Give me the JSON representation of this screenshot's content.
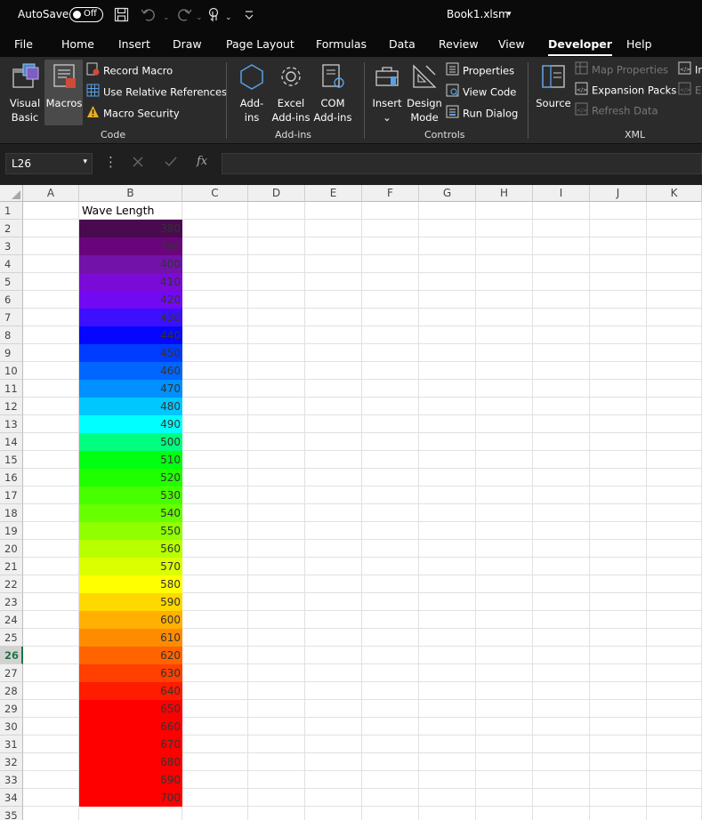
{
  "titlebar": {
    "autosave_label": "AutoSave",
    "toggle_label": "Off",
    "filename": "Book1.xlsm",
    "filename_caret": "▾"
  },
  "tabs": [
    "File",
    "Home",
    "Insert",
    "Draw",
    "Page Layout",
    "Formulas",
    "Data",
    "Review",
    "View",
    "Developer",
    "Help"
  ],
  "active_tab": "Developer",
  "ribbon": {
    "code": {
      "label": "Code",
      "visual_basic": [
        "Visual",
        "Basic"
      ],
      "macros": "Macros",
      "record_macro": "Record Macro",
      "relative_refs": "Use Relative References",
      "macro_security": "Macro Security"
    },
    "addins": {
      "label": "Add-ins",
      "addins": [
        "Add-",
        "ins"
      ],
      "excel_addins": [
        "Excel",
        "Add-ins"
      ],
      "com_addins": [
        "COM",
        "Add-ins"
      ]
    },
    "controls": {
      "label": "Controls",
      "insert": "Insert",
      "insert_caret": "⌄",
      "design_mode": [
        "Design",
        "Mode"
      ],
      "properties": "Properties",
      "view_code": "View Code",
      "run_dialog": "Run Dialog"
    },
    "xml": {
      "label": "XML",
      "source": "Source",
      "map_properties": "Map Properties",
      "expansion_packs": "Expansion Packs",
      "refresh_data": "Refresh Data",
      "clipped_1": "In",
      "clipped_2": "Ex"
    }
  },
  "formula_bar": {
    "name_box": "L26",
    "name_box_caret": "▾",
    "formula_value": ""
  },
  "sheet": {
    "columns": [
      "A",
      "B",
      "C",
      "D",
      "E",
      "F",
      "G",
      "H",
      "I",
      "J",
      "K"
    ],
    "rows": [
      "1",
      "2",
      "3",
      "4",
      "5",
      "6",
      "7",
      "8",
      "9",
      "10",
      "11",
      "12",
      "13",
      "14",
      "15",
      "16",
      "17",
      "18",
      "19",
      "20",
      "21",
      "22",
      "23",
      "24",
      "25",
      "26",
      "27",
      "28",
      "29",
      "30",
      "31",
      "32",
      "33",
      "34",
      "35"
    ],
    "selected_row": "26",
    "header": "Wave Length",
    "cells": [
      {
        "value": "380",
        "color": "#4a0a4e"
      },
      {
        "value": "390",
        "color": "#6a047d"
      },
      {
        "value": "400",
        "color": "#7212a8"
      },
      {
        "value": "410",
        "color": "#7a0ad6"
      },
      {
        "value": "420",
        "color": "#7209f3"
      },
      {
        "value": "430",
        "color": "#3c10ff"
      },
      {
        "value": "440",
        "color": "#0606ff"
      },
      {
        "value": "450",
        "color": "#003cff"
      },
      {
        "value": "460",
        "color": "#0066ff"
      },
      {
        "value": "470",
        "color": "#0090ff"
      },
      {
        "value": "480",
        "color": "#00c8ff"
      },
      {
        "value": "490",
        "color": "#00ffff"
      },
      {
        "value": "500",
        "color": "#00ff80"
      },
      {
        "value": "510",
        "color": "#00ff10"
      },
      {
        "value": "520",
        "color": "#20ff00"
      },
      {
        "value": "530",
        "color": "#48ff00"
      },
      {
        "value": "540",
        "color": "#68ff00"
      },
      {
        "value": "550",
        "color": "#90ff00"
      },
      {
        "value": "560",
        "color": "#b8ff00"
      },
      {
        "value": "570",
        "color": "#dcff00"
      },
      {
        "value": "580",
        "color": "#ffff00"
      },
      {
        "value": "590",
        "color": "#ffd800"
      },
      {
        "value": "600",
        "color": "#ffb000"
      },
      {
        "value": "610",
        "color": "#ff8c00"
      },
      {
        "value": "620",
        "color": "#ff6400"
      },
      {
        "value": "630",
        "color": "#ff4000"
      },
      {
        "value": "640",
        "color": "#ff1c00"
      },
      {
        "value": "650",
        "color": "#ff0000"
      },
      {
        "value": "660",
        "color": "#ff0000"
      },
      {
        "value": "670",
        "color": "#ff0000"
      },
      {
        "value": "680",
        "color": "#ff0000"
      },
      {
        "value": "690",
        "color": "#ff0000"
      },
      {
        "value": "700",
        "color": "#ff0000"
      }
    ]
  },
  "colors": {
    "accent_green": "#217346"
  }
}
